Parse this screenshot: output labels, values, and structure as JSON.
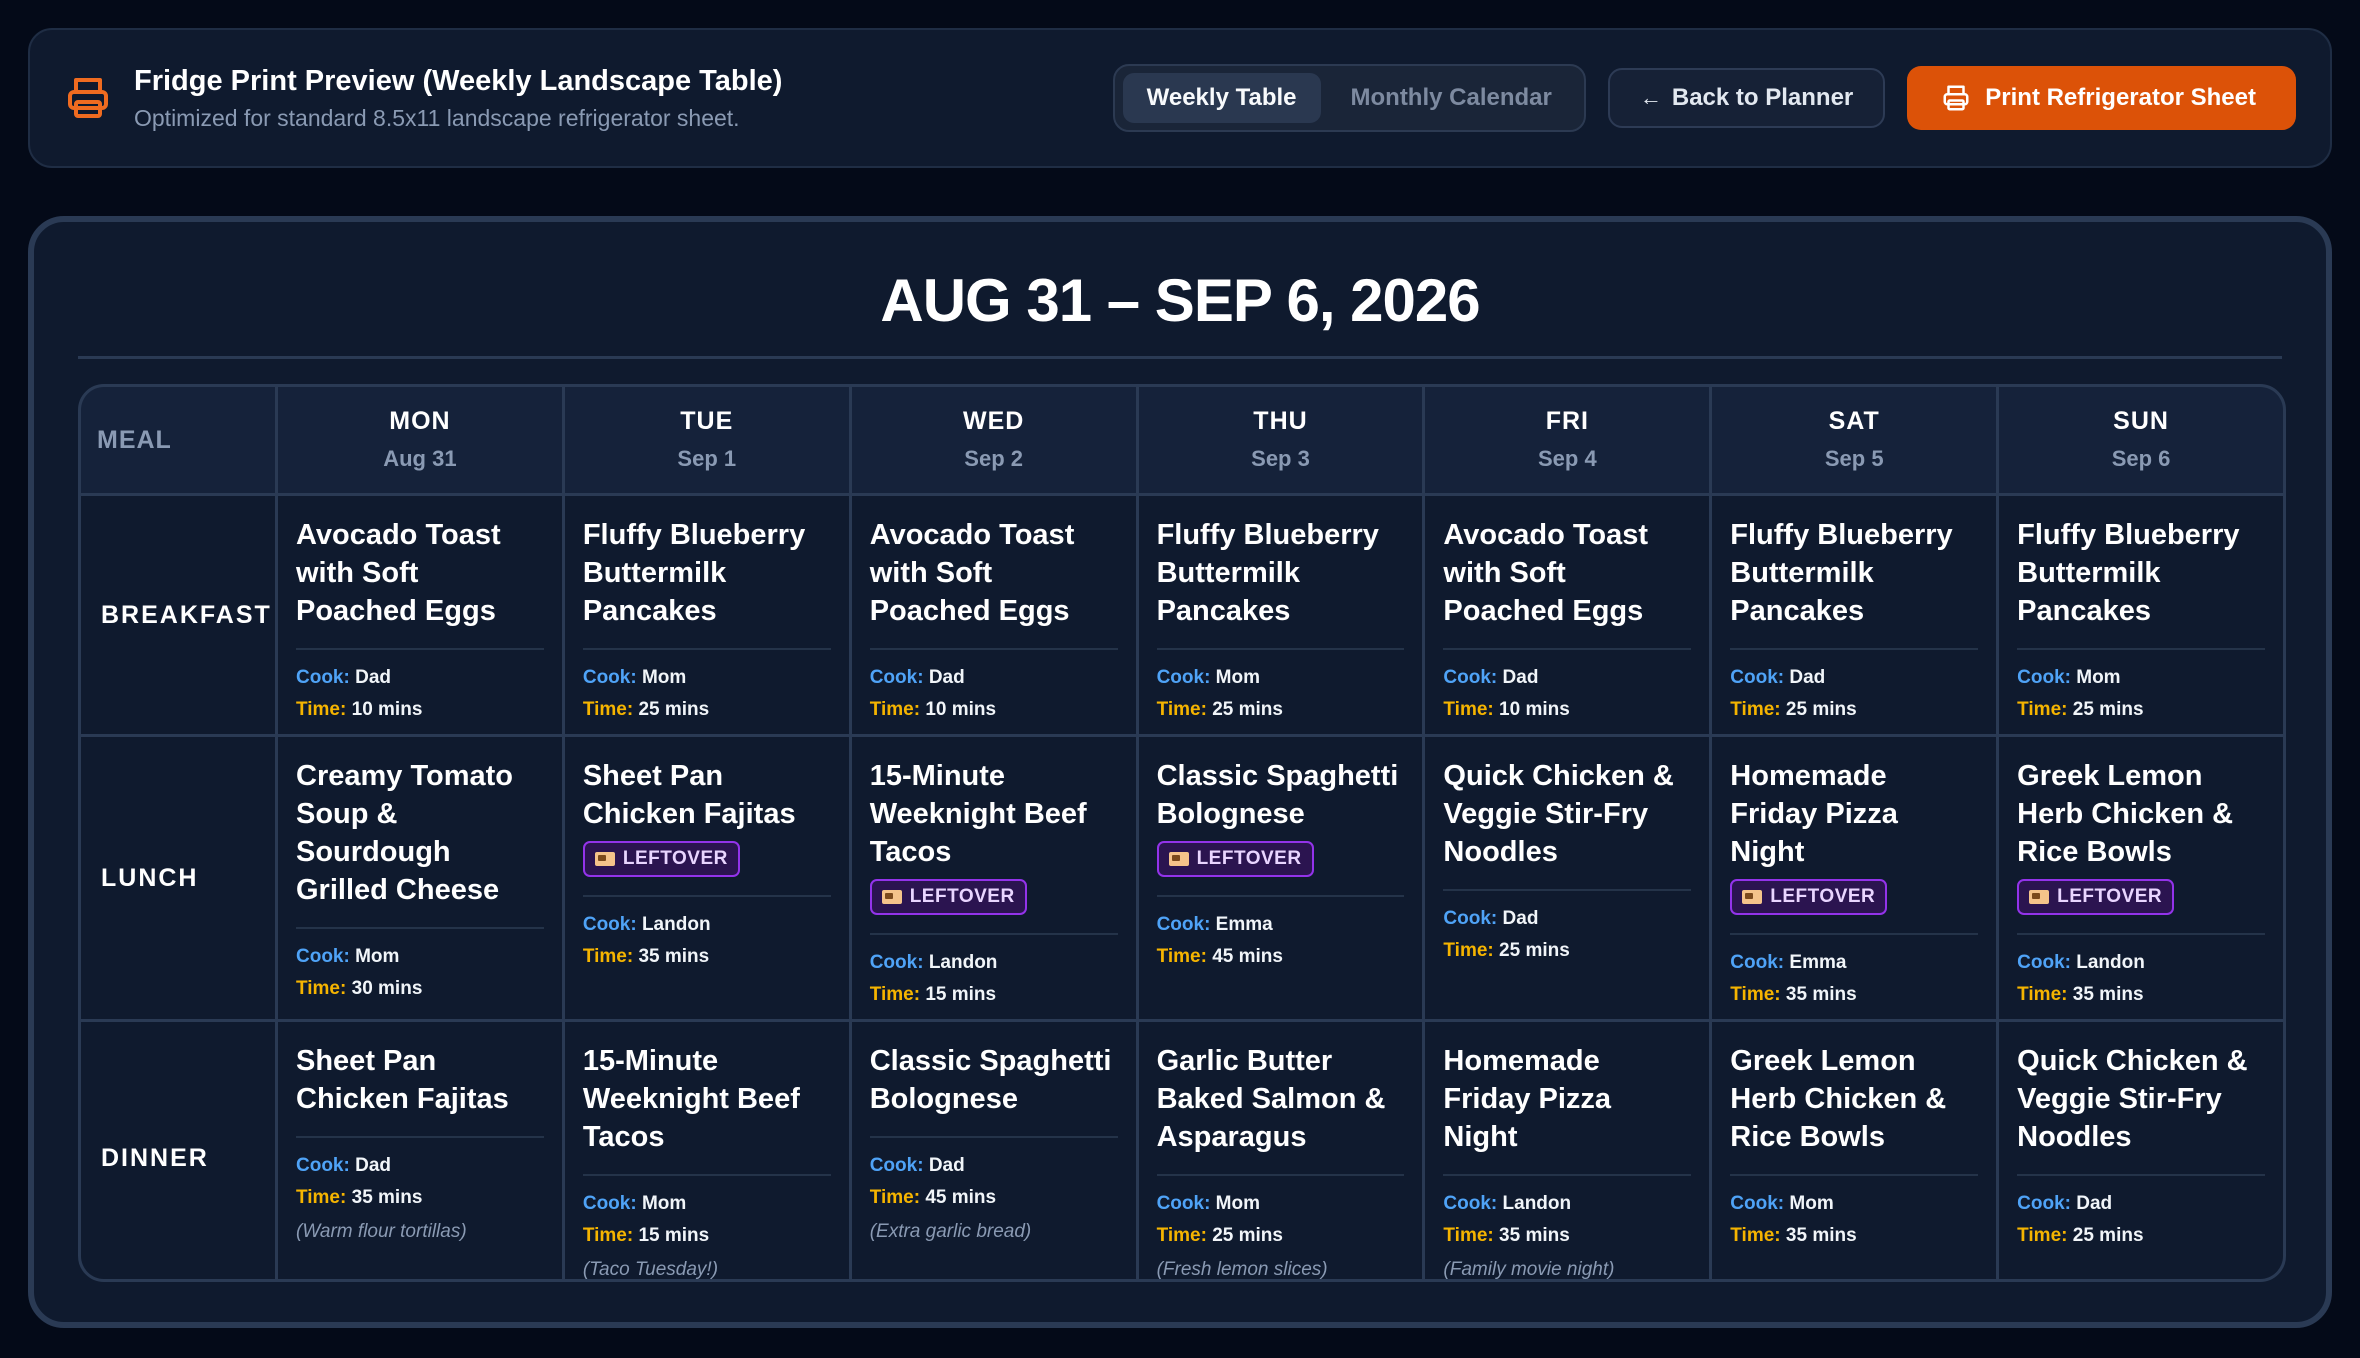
{
  "header": {
    "title": "Fridge Print Preview (Weekly Landscape Table)",
    "subtitle": "Optimized for standard 8.5x11 landscape refrigerator sheet.",
    "view_toggle": {
      "weekly": "Weekly Table",
      "monthly": "Monthly Calendar",
      "active": "weekly"
    },
    "back_label": "Back to Planner",
    "print_label": "Print Refrigerator Sheet"
  },
  "colors": {
    "accent": "#dc5208",
    "cook_key": "#4fa3f7",
    "time_key": "#f5b400",
    "leftover": "#9333ea"
  },
  "sheet": {
    "title": "AUG 31 – SEP 6, 2026",
    "meal_header": "MEAL",
    "cook_key": "Cook:",
    "time_key": "Time:",
    "leftover_label": "LEFTOVER",
    "days": [
      {
        "name": "MON",
        "date": "Aug 31"
      },
      {
        "name": "TUE",
        "date": "Sep 1"
      },
      {
        "name": "WED",
        "date": "Sep 2"
      },
      {
        "name": "THU",
        "date": "Sep 3"
      },
      {
        "name": "FRI",
        "date": "Sep 4"
      },
      {
        "name": "SAT",
        "date": "Sep 5"
      },
      {
        "name": "SUN",
        "date": "Sep 6"
      }
    ],
    "rows": [
      {
        "meal": "BREAKFAST",
        "cells": [
          {
            "dish": "Avocado Toast with Soft Poached Eggs",
            "cook": "Dad",
            "time": "10 mins",
            "leftover": false,
            "note": ""
          },
          {
            "dish": "Fluffy Blueberry Buttermilk Pancakes",
            "cook": "Mom",
            "time": "25 mins",
            "leftover": false,
            "note": ""
          },
          {
            "dish": "Avocado Toast with Soft Poached Eggs",
            "cook": "Dad",
            "time": "10 mins",
            "leftover": false,
            "note": ""
          },
          {
            "dish": "Fluffy Blueberry Buttermilk Pancakes",
            "cook": "Mom",
            "time": "25 mins",
            "leftover": false,
            "note": ""
          },
          {
            "dish": "Avocado Toast with Soft Poached Eggs",
            "cook": "Dad",
            "time": "10 mins",
            "leftover": false,
            "note": ""
          },
          {
            "dish": "Fluffy Blueberry Buttermilk Pancakes",
            "cook": "Dad",
            "time": "25 mins",
            "leftover": false,
            "note": ""
          },
          {
            "dish": "Fluffy Blueberry Buttermilk Pancakes",
            "cook": "Mom",
            "time": "25 mins",
            "leftover": false,
            "note": ""
          }
        ]
      },
      {
        "meal": "LUNCH",
        "cells": [
          {
            "dish": "Creamy Tomato Soup & Sourdough Grilled Cheese",
            "cook": "Mom",
            "time": "30 mins",
            "leftover": false,
            "note": ""
          },
          {
            "dish": "Sheet Pan Chicken Fajitas",
            "cook": "Landon",
            "time": "35 mins",
            "leftover": true,
            "note": ""
          },
          {
            "dish": "15-Minute Weeknight Beef Tacos",
            "cook": "Landon",
            "time": "15 mins",
            "leftover": true,
            "note": ""
          },
          {
            "dish": "Classic Spaghetti Bolognese",
            "cook": "Emma",
            "time": "45 mins",
            "leftover": true,
            "note": ""
          },
          {
            "dish": "Quick Chicken & Veggie Stir-Fry Noodles",
            "cook": "Dad",
            "time": "25 mins",
            "leftover": false,
            "note": ""
          },
          {
            "dish": "Homemade Friday Pizza Night",
            "cook": "Emma",
            "time": "35 mins",
            "leftover": true,
            "note": ""
          },
          {
            "dish": "Greek Lemon Herb Chicken & Rice Bowls",
            "cook": "Landon",
            "time": "35 mins",
            "leftover": true,
            "note": ""
          }
        ]
      },
      {
        "meal": "DINNER",
        "cells": [
          {
            "dish": "Sheet Pan Chicken Fajitas",
            "cook": "Dad",
            "time": "35 mins",
            "leftover": false,
            "note": "(Warm flour tortillas)"
          },
          {
            "dish": "15-Minute Weeknight Beef Tacos",
            "cook": "Mom",
            "time": "15 mins",
            "leftover": false,
            "note": "(Taco Tuesday!)"
          },
          {
            "dish": "Classic Spaghetti Bolognese",
            "cook": "Dad",
            "time": "45 mins",
            "leftover": false,
            "note": "(Extra garlic bread)"
          },
          {
            "dish": "Garlic Butter Baked Salmon & Asparagus",
            "cook": "Mom",
            "time": "25 mins",
            "leftover": false,
            "note": "(Fresh lemon slices)"
          },
          {
            "dish": "Homemade Friday Pizza Night",
            "cook": "Landon",
            "time": "35 mins",
            "leftover": false,
            "note": "(Family movie night)"
          },
          {
            "dish": "Greek Lemon Herb Chicken & Rice Bowls",
            "cook": "Mom",
            "time": "35 mins",
            "leftover": false,
            "note": ""
          },
          {
            "dish": "Quick Chicken & Veggie Stir-Fry Noodles",
            "cook": "Dad",
            "time": "25 mins",
            "leftover": false,
            "note": ""
          }
        ]
      }
    ]
  }
}
